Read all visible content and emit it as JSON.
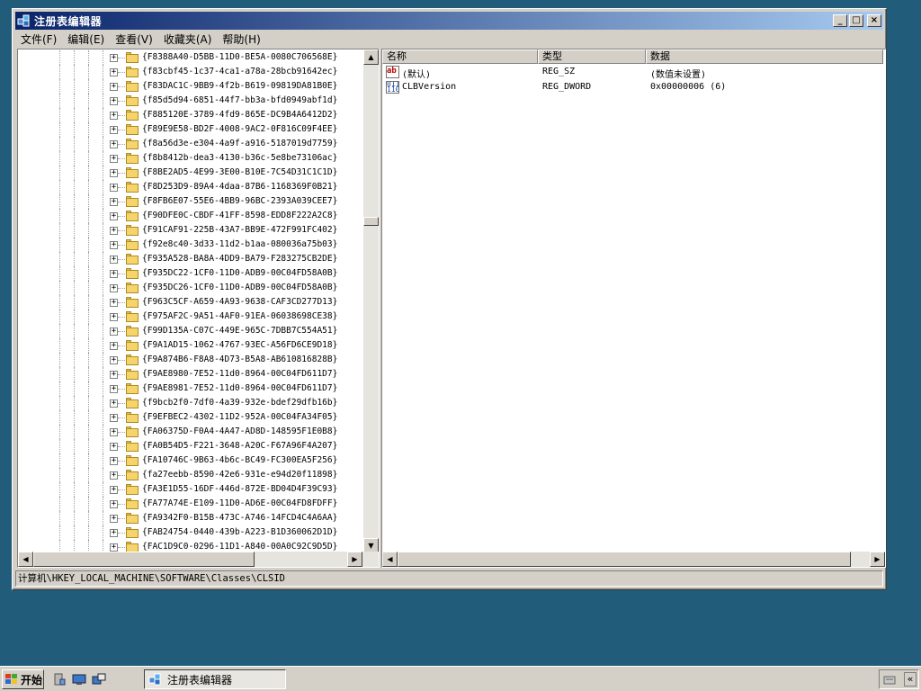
{
  "window": {
    "title": "注册表编辑器",
    "menu": [
      "文件(F)",
      "编辑(E)",
      "查看(V)",
      "收藏夹(A)",
      "帮助(H)"
    ],
    "controls": {
      "minimize": "_",
      "maximize": "□",
      "close": "×"
    }
  },
  "tree": {
    "items": [
      "{F8388A40-D5BB-11D0-BE5A-0080C706568E}",
      "{f83cbf45-1c37-4ca1-a78a-28bcb91642ec}",
      "{F83DAC1C-9BB9-4f2b-B619-09819DA81B0E}",
      "{f85d5d94-6851-44f7-bb3a-bfd0949abf1d}",
      "{F885120E-3789-4fd9-865E-DC9B4A6412D2}",
      "{F89E9E58-BD2F-4008-9AC2-0F816C09F4EE}",
      "{f8a56d3e-e304-4a9f-a916-5187019d7759}",
      "{f8b8412b-dea3-4130-b36c-5e8be73106ac}",
      "{F8BE2AD5-4E99-3E00-B10E-7C54D31C1C1D}",
      "{F8D253D9-89A4-4daa-87B6-1168369F0B21}",
      "{F8FB6E07-55E6-4BB9-96BC-2393A039CEE7}",
      "{F90DFE0C-CBDF-41FF-8598-EDD8F222A2C8}",
      "{F91CAF91-225B-43A7-BB9E-472F991FC402}",
      "{f92e8c40-3d33-11d2-b1aa-080036a75b03}",
      "{F935A528-BA8A-4DD9-BA79-F283275CB2DE}",
      "{F935DC22-1CF0-11D0-ADB9-00C04FD58A0B}",
      "{F935DC26-1CF0-11D0-ADB9-00C04FD58A0B}",
      "{F963C5CF-A659-4A93-9638-CAF3CD277D13}",
      "{F975AF2C-9A51-4AF0-91EA-06038698CE38}",
      "{F99D135A-C07C-449E-965C-7DBB7C554A51}",
      "{F9A1AD15-1062-4767-93EC-A56FD6CE9D18}",
      "{F9A874B6-F8A8-4D73-B5A8-AB610816828B}",
      "{F9AE8980-7E52-11d0-8964-00C04FD611D7}",
      "{F9AE8981-7E52-11d0-8964-00C04FD611D7}",
      "{f9bcb2f0-7df0-4a39-932e-bdef29dfb16b}",
      "{F9EFBEC2-4302-11D2-952A-00C04FA34F05}",
      "{FA06375D-F0A4-4A47-AD8D-148595F1E0B8}",
      "{FA0B54D5-F221-3648-A20C-F67A96F4A207}",
      "{FA10746C-9B63-4b6c-BC49-FC300EA5F256}",
      "{fa27eebb-8590-42e6-931e-e94d20f11898}",
      "{FA3E1D55-16DF-446d-872E-BD04D4F39C93}",
      "{FA77A74E-E109-11D0-AD6E-00C04FD8FDFF}",
      "{FA9342F0-B15B-473C-A746-14FCD4C4A6AA}",
      "{FAB24754-0440-439b-A223-B1D360062D1D}",
      "{FAC1D9C0-0296-11D1-A840-00A0C92C9D5D}"
    ]
  },
  "list": {
    "columns": [
      "名称",
      "类型",
      "数据"
    ],
    "rows": [
      {
        "icon": "ab",
        "name": "(默认)",
        "type": "REG_SZ",
        "data": "(数值未设置)"
      },
      {
        "icon": "bin",
        "name": "CLBVersion",
        "type": "REG_DWORD",
        "data": "0x00000006 (6)"
      }
    ]
  },
  "status": {
    "path": "计算机\\HKEY_LOCAL_MACHINE\\SOFTWARE\\Classes\\CLSID"
  },
  "taskbar": {
    "start_label": "开始",
    "task_label": "注册表编辑器"
  },
  "colors": {
    "desktop": "#215d7b",
    "titlebar_start": "#0a246a",
    "titlebar_end": "#a6caf0",
    "face": "#d4d0c8"
  }
}
